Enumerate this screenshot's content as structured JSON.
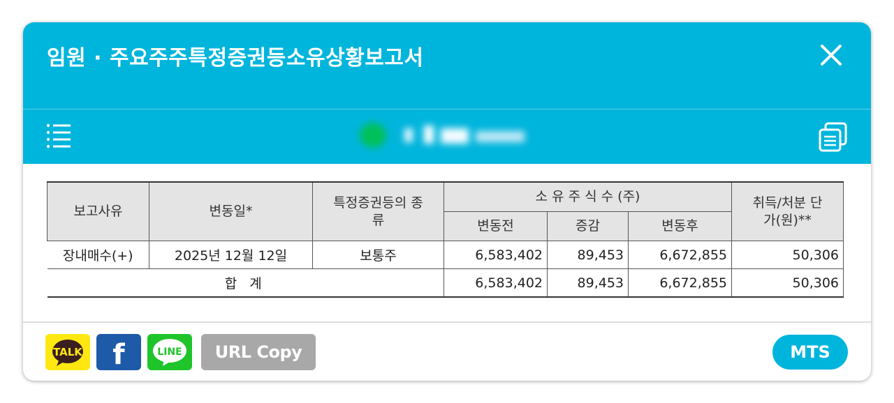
{
  "header": {
    "title": "임원 · 주요주주특정증권등소유상황보고서",
    "close_icon": "close-icon",
    "list_icon": "list-icon",
    "copy_icon": "copy-icon",
    "accent_color": "#00b5dc"
  },
  "table": {
    "headers": {
      "reason": "보고사유",
      "change_date": "변동일*",
      "security_type": "특정증권등의 종류",
      "shares_group": "소 유 주 식 수 (주)",
      "before": "변동전",
      "change": "증감",
      "after": "변동후",
      "unit_price": "취득/처분 단가(원)**"
    },
    "rows": [
      {
        "reason": "장내매수(+)",
        "date": "2025년 12월 12일",
        "type": "보통주",
        "before": "6,583,402",
        "change": "89,453",
        "after": "6,672,855",
        "price": "50,306"
      }
    ],
    "total": {
      "label": "합 계",
      "before": "6,583,402",
      "change": "89,453",
      "after": "6,672,855",
      "price": "50,306"
    }
  },
  "footer": {
    "kakao": {
      "label": "TALK",
      "icon": "kakaotalk-icon",
      "color": "#ffe812"
    },
    "facebook": {
      "label": "f",
      "icon": "facebook-icon",
      "color": "#1d5aa8"
    },
    "line": {
      "label": "LINE",
      "icon": "line-icon",
      "color": "#1fc42a"
    },
    "url_copy": "URL Copy",
    "mts": "MTS"
  }
}
